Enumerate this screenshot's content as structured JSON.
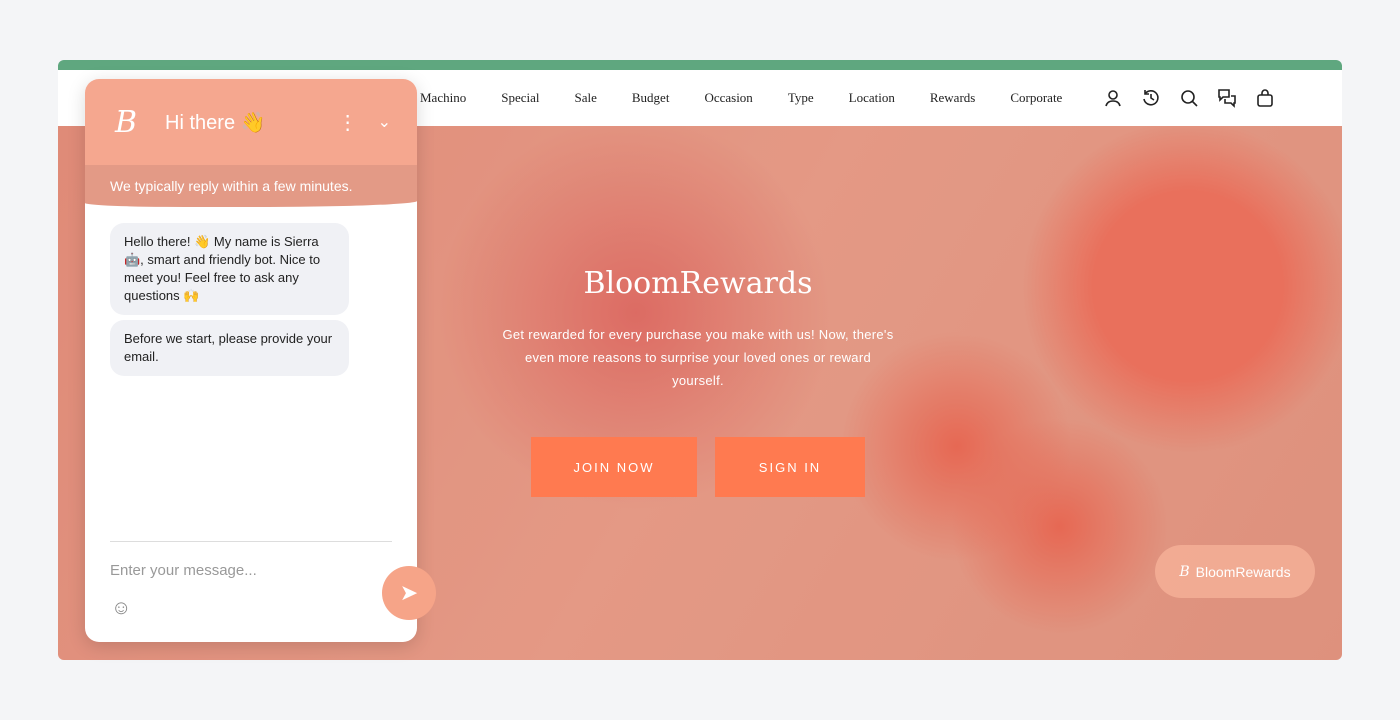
{
  "nav": {
    "items": [
      "Machino",
      "Special",
      "Sale",
      "Budget",
      "Occasion",
      "Type",
      "Location",
      "Rewards",
      "Corporate"
    ],
    "icons": [
      "user-icon",
      "history-icon",
      "search-icon",
      "chat-icon",
      "bag-icon"
    ]
  },
  "hero": {
    "title": "BloomRewards",
    "text": "Get rewarded for every purchase you make with us! Now, there's even more reasons to surprise your loved ones or reward yourself.",
    "join": "JOIN NOW",
    "signin": "SIGN IN",
    "badge": "BloomRewards"
  },
  "chat": {
    "logo": "B",
    "greeting": "Hi there 👋",
    "subtitle": "We typically reply within a few minutes.",
    "messages": [
      "Hello there! 👋 My name is Sierra 🤖, smart and friendly bot. Nice to meet you! Feel free to ask any questions 🙌",
      "Before we start, please provide your email."
    ],
    "placeholder": "Enter your message..."
  },
  "colors": {
    "accent": "#ff7a50",
    "chat_header": "#f5a78f",
    "top_bar": "#5fa77f"
  }
}
